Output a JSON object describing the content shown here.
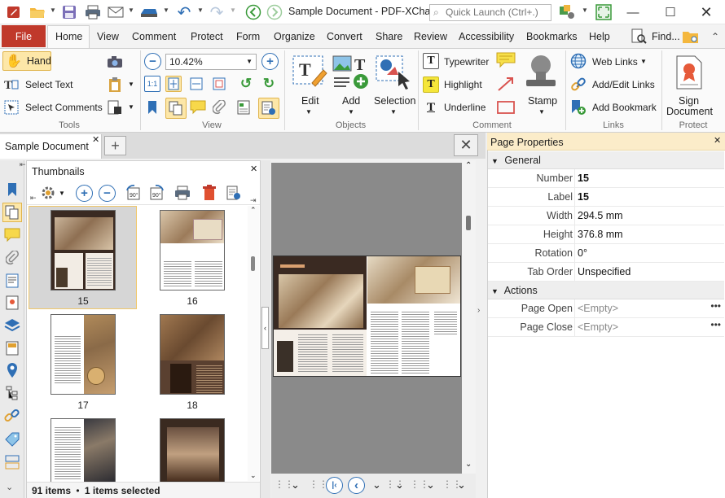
{
  "app": {
    "title": "Sample Document - PDF-XCha...",
    "quick_launch_placeholder": "Quick Launch (Ctrl+.)"
  },
  "menu": {
    "file": "File",
    "items": [
      "Home",
      "View",
      "Comment",
      "Protect",
      "Form",
      "Organize",
      "Convert",
      "Share",
      "Review",
      "Accessibility",
      "Bookmarks",
      "Help"
    ],
    "find": "Find..."
  },
  "ribbon": {
    "tools": {
      "hand": "Hand",
      "select_text": "Select Text",
      "select_comments": "Select Comments",
      "label": "Tools"
    },
    "view": {
      "zoom": "10.42%",
      "label": "View"
    },
    "objects": {
      "edit": "Edit",
      "add": "Add",
      "selection": "Selection",
      "label": "Objects"
    },
    "comment": {
      "typewriter": "Typewriter",
      "highlight": "Highlight",
      "underline": "Underline",
      "stamp": "Stamp",
      "label": "Comment"
    },
    "links": {
      "web_links": "Web Links",
      "add_edit_links": "Add/Edit Links",
      "add_bookmark": "Add Bookmark",
      "label": "Links"
    },
    "protect": {
      "sign_line1": "Sign",
      "sign_line2": "Document",
      "label": "Protect"
    }
  },
  "document_tab": {
    "label": "Sample Document"
  },
  "thumbnails": {
    "title": "Thumbnails",
    "pages": [
      {
        "label": "15",
        "selected": true
      },
      {
        "label": "16",
        "selected": false
      },
      {
        "label": "17",
        "selected": false
      },
      {
        "label": "18",
        "selected": false
      }
    ],
    "status_count": "91 items",
    "status_selected": "1 items selected"
  },
  "properties": {
    "title": "Page Properties",
    "general_label": "General",
    "general": [
      {
        "name": "Number",
        "value": "15",
        "bold": true
      },
      {
        "name": "Label",
        "value": "15",
        "bold": true
      },
      {
        "name": "Width",
        "value": "294.5 mm",
        "bold": false
      },
      {
        "name": "Height",
        "value": "376.8 mm",
        "bold": false
      },
      {
        "name": "Rotation",
        "value": "0°",
        "bold": false
      },
      {
        "name": "Tab Order",
        "value": "Unspecified",
        "bold": false
      }
    ],
    "actions_label": "Actions",
    "actions": [
      {
        "name": "Page Open",
        "value": "<Empty>"
      },
      {
        "name": "Page Close",
        "value": "<Empty>"
      }
    ]
  },
  "colors": {
    "file_tab": "#c0392b",
    "accent_blue": "#2f6fb5",
    "highlight_yellow": "#f5e63a",
    "props_header": "#fbecc9"
  }
}
